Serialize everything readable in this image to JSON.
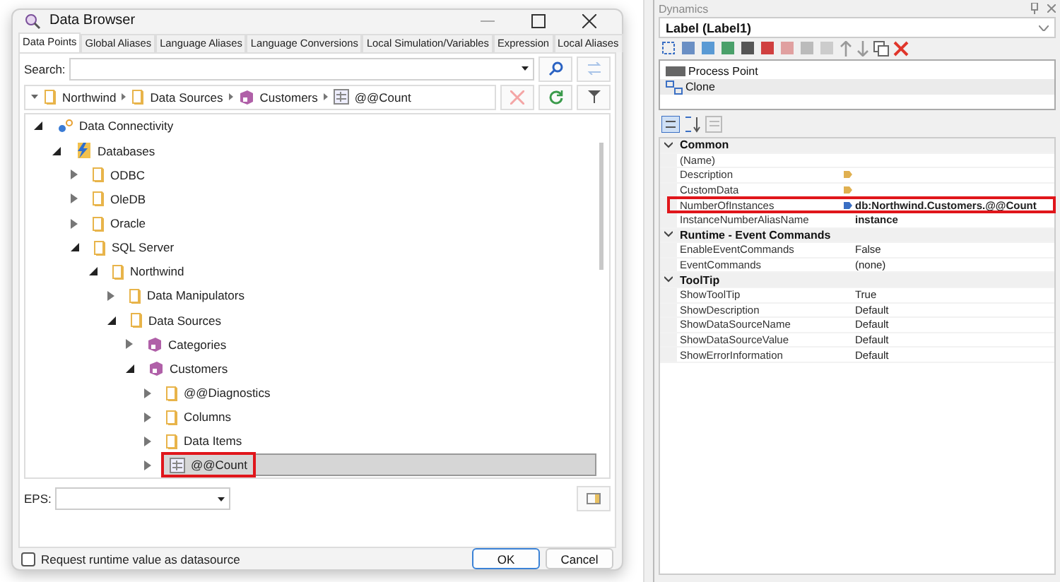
{
  "dialog": {
    "title": "Data Browser",
    "tabs": [
      {
        "label": "Data Points",
        "selected": true
      },
      {
        "label": "Global Aliases",
        "selected": false
      },
      {
        "label": "Language Aliases",
        "selected": false
      },
      {
        "label": "Language Conversions",
        "selected": false
      },
      {
        "label": "Local Simulation/Variables",
        "selected": false
      },
      {
        "label": "Expression",
        "selected": false
      },
      {
        "label": "Local Aliases",
        "selected": false
      }
    ],
    "search": {
      "label": "Search:"
    },
    "breadcrumb": [
      {
        "label": "Northwind",
        "kind": "folder"
      },
      {
        "label": "Data Sources",
        "kind": "folder"
      },
      {
        "label": "Customers",
        "kind": "table"
      },
      {
        "label": "@@Count",
        "kind": "item"
      }
    ],
    "tree": [
      {
        "label": "Data Connectivity",
        "kind": "connectivity",
        "expanded": true,
        "selected": false,
        "children": [
          {
            "label": "Databases",
            "kind": "database",
            "expanded": true,
            "selected": false,
            "children": [
              {
                "label": "ODBC",
                "kind": "folder",
                "expanded": false,
                "selected": false
              },
              {
                "label": "OleDB",
                "kind": "folder",
                "expanded": false,
                "selected": false
              },
              {
                "label": "Oracle",
                "kind": "folder",
                "expanded": false,
                "selected": false
              },
              {
                "label": "SQL Server",
                "kind": "folder",
                "expanded": true,
                "selected": false,
                "children": [
                  {
                    "label": "Northwind",
                    "kind": "folder",
                    "expanded": true,
                    "selected": false,
                    "children": [
                      {
                        "label": "Data Manipulators",
                        "kind": "folder",
                        "expanded": false,
                        "selected": false
                      },
                      {
                        "label": "Data Sources",
                        "kind": "folder",
                        "expanded": true,
                        "selected": false,
                        "children": [
                          {
                            "label": "Categories",
                            "kind": "table",
                            "expanded": false,
                            "selected": false
                          },
                          {
                            "label": "Customers",
                            "kind": "table",
                            "expanded": true,
                            "selected": false,
                            "children": [
                              {
                                "label": "@@Diagnostics",
                                "kind": "folder",
                                "expanded": false,
                                "selected": false
                              },
                              {
                                "label": "Columns",
                                "kind": "folder",
                                "expanded": false,
                                "selected": false
                              },
                              {
                                "label": "Data Items",
                                "kind": "folder",
                                "expanded": false,
                                "selected": false
                              },
                              {
                                "label": "@@Count",
                                "kind": "item",
                                "expanded": false,
                                "selected": true,
                                "highlighted": true
                              }
                            ]
                          }
                        ]
                      }
                    ]
                  }
                ]
              }
            ]
          }
        ]
      }
    ],
    "eps": {
      "label": "EPS:"
    },
    "checkbox": {
      "label": "Request runtime value as datasource",
      "checked": false
    },
    "buttons": [
      "OK",
      "Cancel"
    ]
  },
  "dynamics": {
    "title": "Dynamics",
    "combo": "Label (Label1)",
    "items": [
      {
        "label": "Process Point",
        "kind": "process",
        "selected": false
      },
      {
        "label": "Clone",
        "kind": "clone",
        "selected": true
      }
    ],
    "groups": [
      {
        "name": "Common",
        "expanded": true,
        "rows": [
          {
            "name": "(Name)",
            "value": ""
          },
          {
            "name": "Description",
            "value": "",
            "color": "#e0b050"
          },
          {
            "name": "CustomData",
            "value": "",
            "color": "#e0b050"
          },
          {
            "name": "NumberOfInstances",
            "value": "db:Northwind.Customers.@@Count",
            "color": "#3a6fc4",
            "bold": true,
            "highlighted": true
          },
          {
            "name": "InstanceNumberAliasName",
            "value": "instance",
            "bold": true
          }
        ]
      },
      {
        "name": "Runtime - Event Commands",
        "expanded": true,
        "rows": [
          {
            "name": "EnableEventCommands",
            "value": "False"
          },
          {
            "name": "EventCommands",
            "value": "(none)"
          }
        ]
      },
      {
        "name": "ToolTip",
        "expanded": true,
        "rows": [
          {
            "name": "ShowToolTip",
            "value": "True"
          },
          {
            "name": "ShowDescription",
            "value": "Default"
          },
          {
            "name": "ShowDataSourceName",
            "value": "Default"
          },
          {
            "name": "ShowDataSourceValue",
            "value": "Default"
          },
          {
            "name": "ShowErrorInformation",
            "value": "Default"
          }
        ]
      }
    ]
  }
}
